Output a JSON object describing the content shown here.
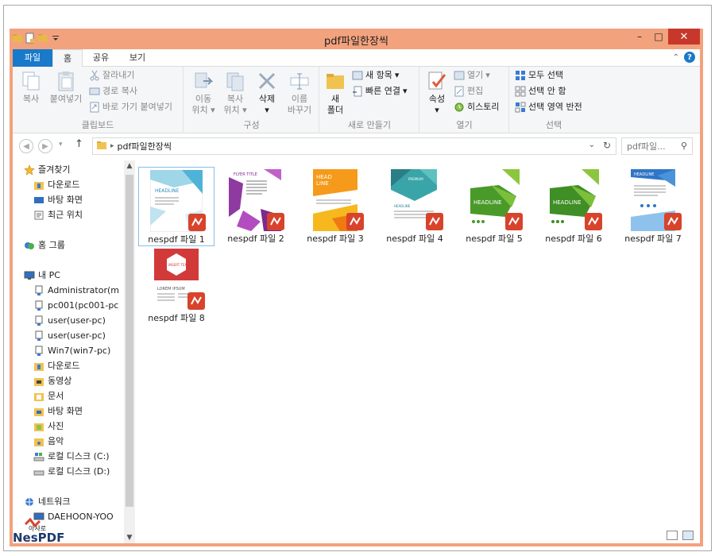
{
  "window": {
    "title": "pdf파일한장씩"
  },
  "quick_access": [
    "folder-icon",
    "properties-icon",
    "new-folder-icon",
    "qat-dropdown-icon"
  ],
  "window_buttons": {
    "minimize": "–",
    "maximize": "□",
    "close": "✕"
  },
  "tabs": {
    "file": "파일",
    "home": "홈",
    "share": "공유",
    "view": "보기"
  },
  "ribbon": {
    "clipboard": {
      "label": "클립보드",
      "copy": "복사",
      "paste": "붙여넣기",
      "cut": "잘라내기",
      "copy_path": "경로 복사",
      "paste_shortcut": "바로 가기 붙여넣기"
    },
    "organize": {
      "label": "구성",
      "move_to_1": "이동",
      "move_to_2": "위치",
      "copy_to_1": "복사",
      "copy_to_2": "위치",
      "delete": "삭제",
      "rename_1": "이름",
      "rename_2": "바꾸기"
    },
    "new": {
      "label": "새로 만들기",
      "new_folder_1": "새",
      "new_folder_2": "폴더",
      "new_item": "새 항목",
      "easy_access": "빠른 연결"
    },
    "open": {
      "label": "열기",
      "properties": "속성",
      "open": "열기",
      "edit": "편집",
      "history": "히스토리"
    },
    "select": {
      "label": "선택",
      "select_all": "모두 선택",
      "select_none": "선택 안 함",
      "invert": "선택 영역 반전"
    }
  },
  "address": {
    "path": "pdf파일한장씩",
    "search_placeholder": "pdf파일..."
  },
  "nav": {
    "favorites": "즐겨찾기",
    "downloads": "다운로드",
    "desktop": "바탕 화면",
    "recent": "최근 위치",
    "homegroup": "홈 그룹",
    "this_pc": "내 PC",
    "net1": "Administrator(m",
    "net2": "pc001(pc001-pc",
    "net3": "user(user-pc)",
    "net4": "user(user-pc)",
    "net5": "Win7(win7-pc)",
    "downloads2": "다운로드",
    "videos": "동영상",
    "documents": "문서",
    "desktop2": "바탕 화면",
    "pictures": "사진",
    "music": "음악",
    "local_c": "로컬 디스크 (C:)",
    "local_d": "로컬 디스크 (D:)",
    "network": "네트워크",
    "network_pc": "DAEHOON-YOO"
  },
  "files": [
    {
      "name": "nespdf 파일 1",
      "theme": "blue"
    },
    {
      "name": "nespdf 파일 2",
      "theme": "purple"
    },
    {
      "name": "nespdf 파일 3",
      "theme": "orange"
    },
    {
      "name": "nespdf 파일 4",
      "theme": "teal"
    },
    {
      "name": "nespdf 파일 5",
      "theme": "green"
    },
    {
      "name": "nespdf 파일 6",
      "theme": "green"
    },
    {
      "name": "nespdf 파일 7",
      "theme": "navy"
    },
    {
      "name": "nespdf 파일 8",
      "theme": "red"
    }
  ],
  "thumb_text": {
    "f1": "HEADLINE",
    "f2": "FLYER TITLE",
    "f3_1": "HEAD",
    "f3_2": "LINE",
    "f4_1": "PREMIUM",
    "f4_2": "HEADLINE",
    "f5": "HEADLINE",
    "f6": "HEADLINE",
    "f7": "HEADLINE",
    "f8_badge": "INSERT TEXT",
    "f8_lorem": "LOREM IPSUM"
  },
  "logo": {
    "text": "NesPDF",
    "caption": "아샤로"
  },
  "colors": {
    "accent": "#1979ca",
    "title_bar": "#f2a27d",
    "close": "#c8372b",
    "nespdf_badge": "#d8432c"
  }
}
